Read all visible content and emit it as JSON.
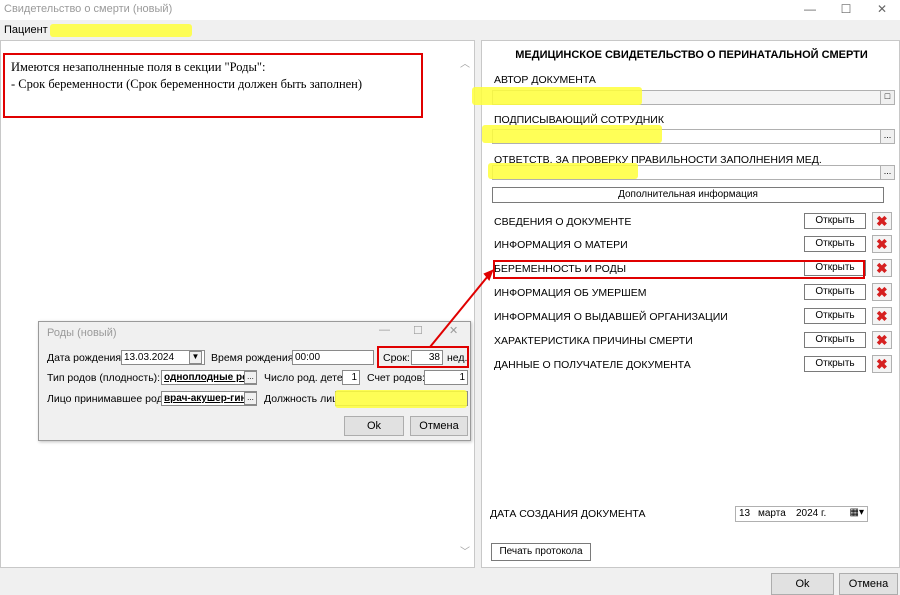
{
  "window": {
    "title": "Свидетельство о смерти (новый)",
    "controls": {
      "minimize": "—",
      "maximize": "☐",
      "close": "✕"
    }
  },
  "menubar": {
    "patient_label": "Пациент"
  },
  "error_message": {
    "line1": "Имеются незаполненные поля в секции \"Роды\":",
    "line2": "- Срок беременности (Срок беременности должен быть заполнен)"
  },
  "right_panel": {
    "title": "МЕДИЦИНСКОЕ СВИДЕТЕЛЬСТВО О ПЕРИНАТАЛЬНОЙ СМЕРТИ",
    "author_label": "АВТОР ДОКУМЕНТА",
    "signer_label": "ПОДПИСЫВАЮЩИЙ СОТРУДНИК",
    "responsible_label": "ОТВЕТСТВ. ЗА ПРОВЕРКУ ПРАВИЛЬНОСТИ ЗАПОЛНЕНИЯ МЕД. СВИДЕТЕЛЬСТВА",
    "additional_info_button": "Дополнительная информация",
    "open_label": "Открыть",
    "sections": [
      "СВЕДЕНИЯ О ДОКУМЕНТЕ",
      "ИНФОРМАЦИЯ О МАТЕРИ",
      "БЕРЕМЕННОСТЬ И РОДЫ",
      "ИНФОРМАЦИЯ ОБ УМЕРШЕМ",
      "ИНФОРМАЦИЯ О ВЫДАВШЕЙ ОРГАНИЗАЦИИ",
      "ХАРАКТЕРИСТИКА ПРИЧИНЫ СМЕРТИ",
      "ДАННЫЕ О ПОЛУЧАТЕЛЕ ДОКУМЕНТА"
    ],
    "creation_date_label": "ДАТА СОЗДАНИЯ ДОКУМЕНТА",
    "creation_date": {
      "day": "13",
      "month": "марта",
      "year": "2024 г."
    },
    "print_button": "Печать протокола"
  },
  "footer": {
    "ok": "Ok",
    "cancel": "Отмена"
  },
  "dialog": {
    "title": "Роды (новый)",
    "birth_date_label": "Дата рождения:",
    "birth_date": "13.03.2024",
    "birth_time_label": "Время рождения:",
    "birth_time": "00:00",
    "term_label": "Срок:",
    "term_value": "38",
    "term_unit": "нед.",
    "birth_type_label": "Тип родов (плодность):",
    "birth_type_value": "одноплодные ро",
    "children_count_label": "Число род. детей:",
    "children_count": "1",
    "birth_order_label": "Счет родов:",
    "birth_order": "1",
    "attendant_label": "Лицо принимавшее роды:",
    "attendant_value": "врач-акушер-гин",
    "position_label": "Должность лица",
    "ok": "Ok",
    "cancel": "Отмена"
  },
  "colors": {
    "highlight": "#ffff3a",
    "annotation_red": "#e00000"
  }
}
